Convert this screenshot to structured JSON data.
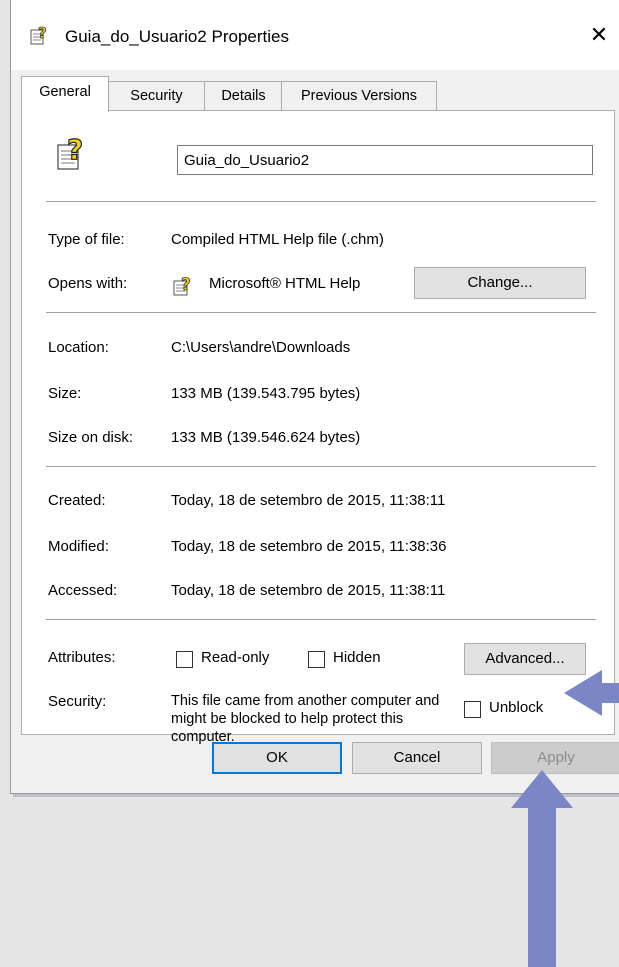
{
  "window": {
    "title": "Guia_do_Usuario2 Properties",
    "close": "✕"
  },
  "tabs": [
    {
      "label": "General",
      "active": true
    },
    {
      "label": "Security",
      "active": false
    },
    {
      "label": "Details",
      "active": false
    },
    {
      "label": "Previous Versions",
      "active": false
    }
  ],
  "general": {
    "file_name": "Guia_do_Usuario2",
    "type_label": "Type of file:",
    "type_value": "Compiled HTML Help file (.chm)",
    "opens_label": "Opens with:",
    "opens_value": "Microsoft® HTML Help",
    "change_button": "Change...",
    "location_label": "Location:",
    "location_value": "C:\\Users\\andre\\Downloads",
    "size_label": "Size:",
    "size_value": "133 MB (139.543.795 bytes)",
    "size_disk_label": "Size on disk:",
    "size_disk_value": "133 MB (139.546.624 bytes)",
    "created_label": "Created:",
    "created_value": "Today, 18 de setembro de 2015, 11:38:11",
    "modified_label": "Modified:",
    "modified_value": "Today, 18 de setembro de 2015, 11:38:36",
    "accessed_label": "Accessed:",
    "accessed_value": "Today, 18 de setembro de 2015, 11:38:11",
    "attributes_label": "Attributes:",
    "readonly_label": "Read-only",
    "hidden_label": "Hidden",
    "advanced_button": "Advanced...",
    "security_label": "Security:",
    "security_text": "This file came from another computer and might be blocked to help protect this computer.",
    "unblock_label": "Unblock"
  },
  "buttons": {
    "ok": "OK",
    "cancel": "Cancel",
    "apply": "Apply"
  },
  "colors": {
    "accent": "#0078d7",
    "arrow": "#7b86c6",
    "icon_yellow": "#f2d21a"
  }
}
